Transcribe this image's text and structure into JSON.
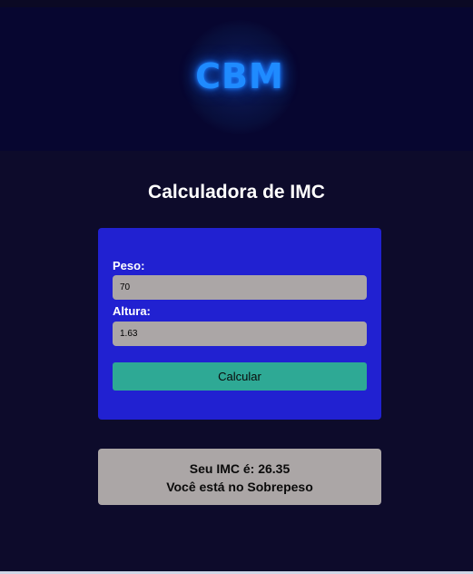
{
  "header": {
    "logo_text": "CBM"
  },
  "title": "Calculadora de IMC",
  "form": {
    "peso_label": "Peso:",
    "peso_value": "70",
    "altura_label": "Altura:",
    "altura_value": "1.63",
    "calcular_label": "Calcular"
  },
  "result": {
    "imc_line": "Seu IMC é: 26.35",
    "status_line": "Você está no Sobrepeso"
  },
  "colors": {
    "page_background": "#0d0b2b",
    "header_background": "#070630",
    "logo_blue": "#1f8bff",
    "form_card": "#2121d1",
    "input_background": "#aba6a6",
    "calcular_button": "#2ea995",
    "result_card": "#aba6a6"
  }
}
